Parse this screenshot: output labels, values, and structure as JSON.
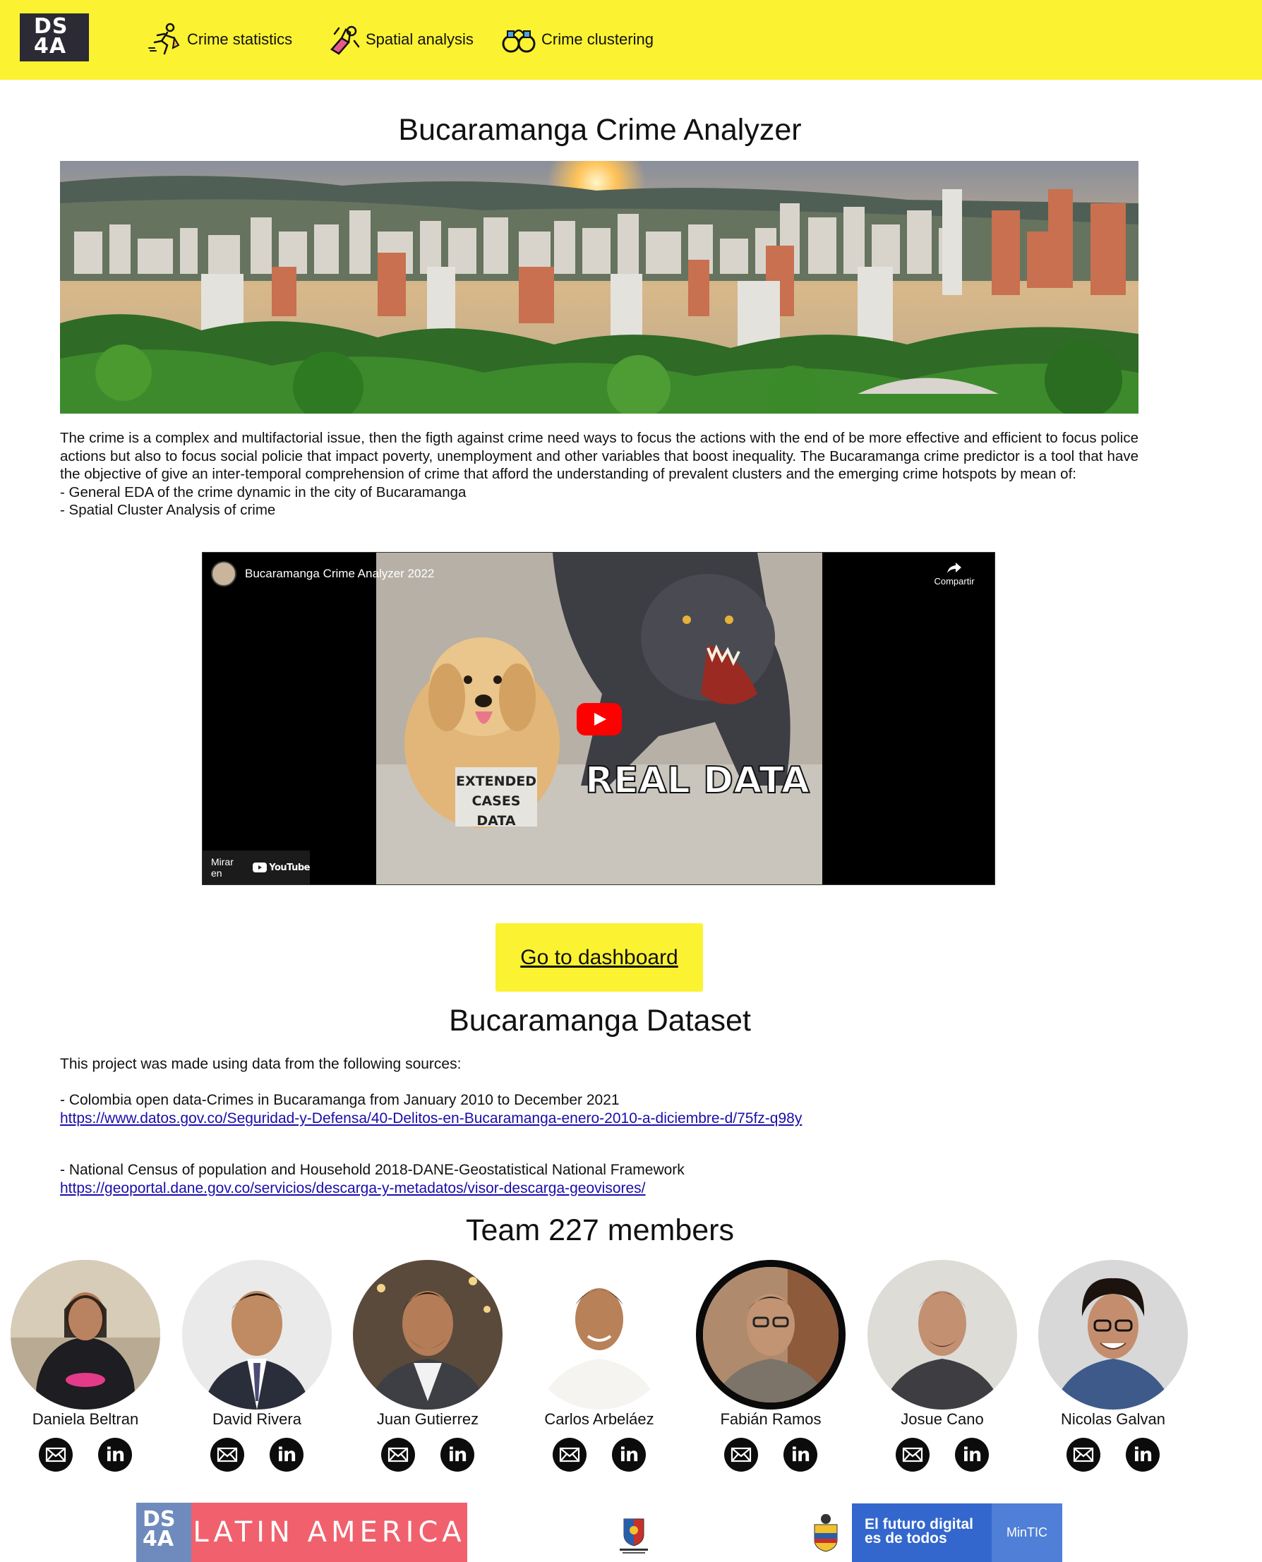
{
  "nav": {
    "logo_line1": "DS",
    "logo_line2": "4A",
    "items": [
      {
        "label": "Crime statistics",
        "icon": "thief-running-icon"
      },
      {
        "label": "Spatial analysis",
        "icon": "handcuffed-hands-icon"
      },
      {
        "label": "Crime clustering",
        "icon": "handcuffs-icon"
      }
    ]
  },
  "main": {
    "title": "Bucaramanga Crime Analyzer",
    "intro": [
      "The crime is a complex and multifactorial issue, then the figth against crime need ways to focus the actions with the end of be more effective and efficient to focus police actions but also to focus social policie that impact poverty, unemployment and other variables that boost inequality. The Bucaramanga crime predictor is a tool that have the objective of give an inter-temporal comprehension of crime that afford the understanding of prevalent clusters and the emerging crime hotspots by mean of:",
      "- General EDA of the crime dynamic in the city of Bucaramanga",
      "- Spatial Cluster Analysis of crime"
    ]
  },
  "video": {
    "title": "Bucaramanga Crime Analyzer 2022",
    "share_label": "Compartir",
    "watch_on": "Mirar en",
    "youtube": "YouTube",
    "meme_left": [
      "EXTENDED",
      "CASES",
      "DATA"
    ],
    "meme_right": "REAL DATA"
  },
  "dashboard_button": "Go to dashboard",
  "dataset": {
    "title": "Bucaramanga Dataset",
    "intro": "This project was made using data from the following sources:",
    "sources": [
      {
        "desc": "- Colombia open data-Crimes in Bucaramanga from January 2010 to December 2021",
        "url": "https://www.datos.gov.co/Seguridad-y-Defensa/40-Delitos-en-Bucaramanga-enero-2010-a-diciembre-d/75fz-q98y"
      },
      {
        "desc": "- National Census of population and Household 2018-DANE-Geostatistical National Framework",
        "url": "https://geoportal.dane.gov.co/servicios/descarga-y-metadatos/visor-descarga-geovisores/"
      }
    ]
  },
  "team": {
    "title": "Team 227 members",
    "members": [
      {
        "name": "Daniela Beltran"
      },
      {
        "name": "David Rivera"
      },
      {
        "name": "Juan Gutierrez"
      },
      {
        "name": "Carlos Arbeláez"
      },
      {
        "name": "Fabián Ramos"
      },
      {
        "name": "Josue Cano"
      },
      {
        "name": "Nicolas Galvan"
      }
    ],
    "linkedin_label": "in"
  },
  "footer": {
    "ds4a_line1": "DS",
    "ds4a_line2": "4A",
    "latam": "LATIN AMERICA",
    "alcaldia": "Alcaldía de Bucaramanga",
    "futuro_line1": "El futuro digital",
    "futuro_line2": "es de todos",
    "mintic": "MinTIC"
  }
}
